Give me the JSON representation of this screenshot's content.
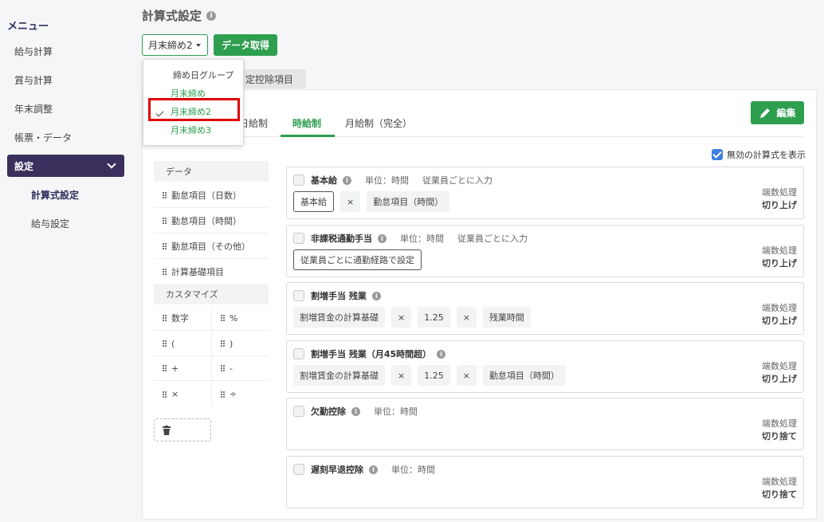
{
  "sidebar": {
    "title": "メニュー",
    "items": [
      "給与計算",
      "賞与計算",
      "年末調整",
      "帳票・データ"
    ],
    "active_item": "設定",
    "sub_items": [
      "計算式設定",
      "給与設定"
    ]
  },
  "header": {
    "title": "計算式設定",
    "group_select": "月末締め2",
    "fetch_button": "データ取得"
  },
  "top_tab": "定控除項目",
  "tabs": [
    "日給制",
    "時給制",
    "月給制（完全）"
  ],
  "active_tab": "時給制",
  "edit_button": "編集",
  "show_invalid_label": "無効の計算式を表示",
  "palette": {
    "data_header": "データ",
    "data_items": [
      "勤怠項目（日数）",
      "勤怠項目（時間）",
      "勤怠項目（その他）",
      "計算基礎項目"
    ],
    "custom_header": "カスタマイズ",
    "custom_items": [
      "数字",
      "%",
      "(",
      ")",
      "+",
      "-",
      "×",
      "÷"
    ]
  },
  "cards": [
    {
      "title": "基本給",
      "unit": "単位：時間",
      "input": "従業員ごとに入力",
      "chips": [
        "基本給",
        "×",
        "勤怠項目（時間）"
      ],
      "rounding_label": "端数処理",
      "rounding_value": "切り上げ"
    },
    {
      "title": "非課税通勤手当",
      "unit": "単位：時間",
      "input": "従業員ごとに入力",
      "chips": [
        "従業員ごとに通勤経路で設定"
      ],
      "rounding_label": "端数処理",
      "rounding_value": "切り上げ"
    },
    {
      "title": "割増手当 残業",
      "unit": "",
      "input": "",
      "chips": [
        "割増賃金の計算基礎",
        "×",
        "1.25",
        "×",
        "残業時間"
      ],
      "rounding_label": "端数処理",
      "rounding_value": "切り上げ"
    },
    {
      "title": "割増手当 残業（月45時間超）",
      "unit": "",
      "input": "",
      "chips": [
        "割増賃金の計算基礎",
        "×",
        "1.25",
        "×",
        "勤怠項目（時間）"
      ],
      "rounding_label": "端数処理",
      "rounding_value": "切り上げ"
    },
    {
      "title": "欠勤控除",
      "unit": "単位：時間",
      "input": "",
      "chips": [],
      "rounding_label": "端数処理",
      "rounding_value": "切り捨て"
    },
    {
      "title": "遅刻早退控除",
      "unit": "単位：時間",
      "input": "",
      "chips": [],
      "rounding_label": "端数処理",
      "rounding_value": "切り捨て"
    }
  ],
  "dropdown": {
    "header": "締め日グループ",
    "options": [
      "月末締め",
      "月末締め2",
      "月末締め3"
    ],
    "selected": "月末締め2"
  },
  "colors": {
    "accent_green": "#2e9e4f",
    "sidebar_active": "#3b2f5e",
    "highlight_red": "#e00000",
    "checkbox_blue": "#3e7fe0"
  }
}
